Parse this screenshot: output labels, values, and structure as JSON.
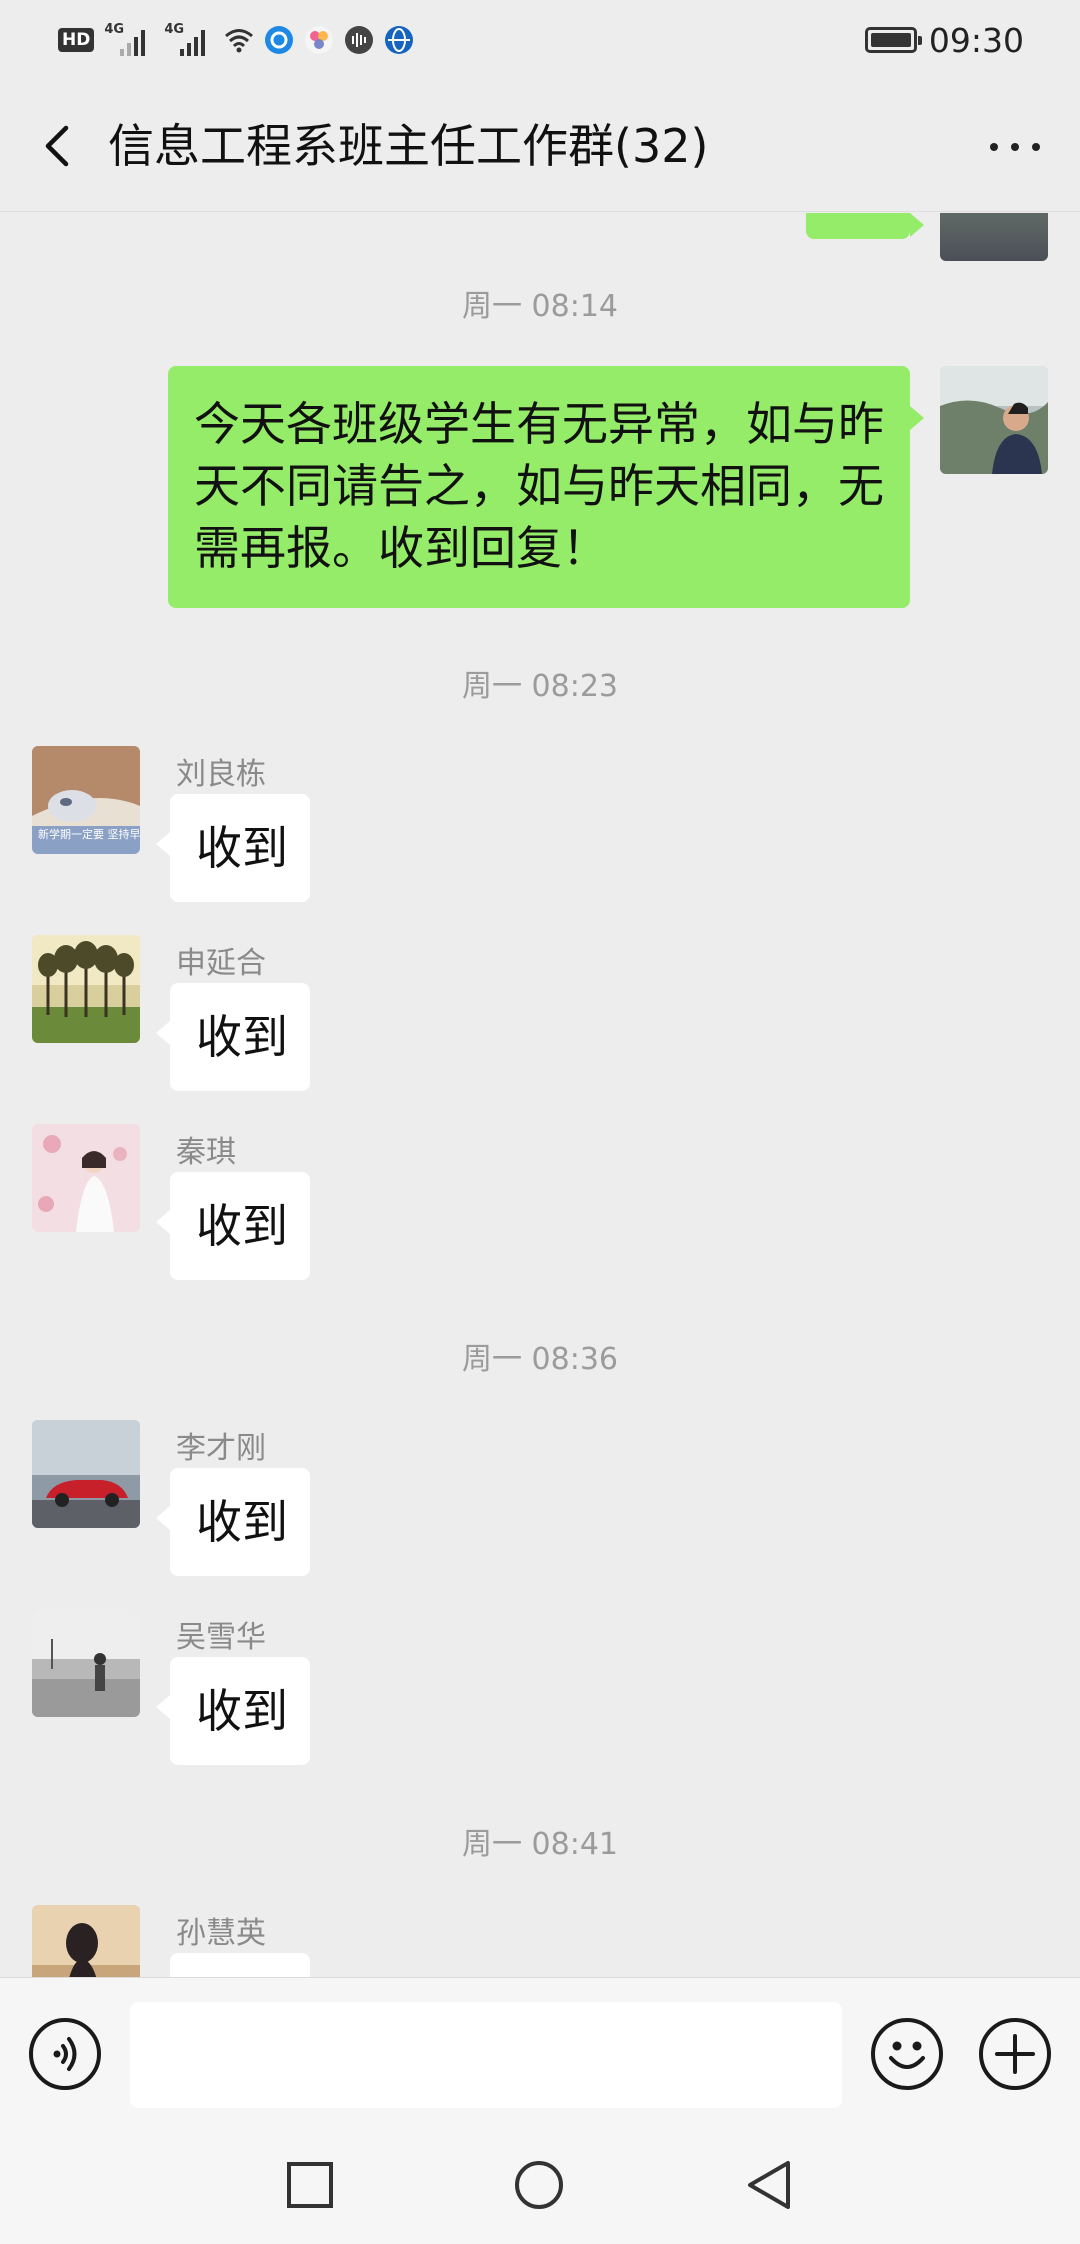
{
  "status_bar": {
    "hd_label": "HD",
    "sim1_label": "4G",
    "sim2_label": "4G",
    "time": "09:30"
  },
  "header": {
    "title": "信息工程系班主任工作群(32)"
  },
  "chat": {
    "messages": [
      {
        "type": "timestamp",
        "text": "周一 08:14"
      },
      {
        "type": "outgoing",
        "text": "今天各班级学生有无异常，如与昨天不同请告之，如与昨天相同，无需再报。收到回复！",
        "lines": [
          "今天各班级学生有无异常，如与昨",
          "天不同请告之，如与昨天相同，无",
          "需再报。收到回复！"
        ]
      },
      {
        "type": "timestamp",
        "text": "周一 08:23"
      },
      {
        "type": "incoming",
        "sender": "刘良栋",
        "text": "收到",
        "avatar_caption": "新学期一定要 坚持早睡早起"
      },
      {
        "type": "incoming",
        "sender": "申延合",
        "text": "收到"
      },
      {
        "type": "incoming",
        "sender": "秦琪",
        "text": "收到"
      },
      {
        "type": "timestamp",
        "text": "周一 08:36"
      },
      {
        "type": "incoming",
        "sender": "李才刚",
        "text": "收到"
      },
      {
        "type": "incoming",
        "sender": "吴雪华",
        "text": "收到"
      },
      {
        "type": "timestamp",
        "text": "周一 08:41"
      },
      {
        "type": "incoming",
        "sender": "孙慧英",
        "text": ""
      }
    ]
  },
  "input_bar": {
    "value": "",
    "placeholder": ""
  },
  "icons": {
    "back": "chevron-left-icon",
    "more": "more-dots-icon",
    "voice": "voice-input-icon",
    "emoji": "emoji-icon",
    "add": "plus-icon",
    "recents": "square-icon",
    "home": "circle-icon",
    "back_nav": "triangle-back-icon"
  },
  "colors": {
    "background": "#ededed",
    "outgoing_bubble": "#95ec69",
    "incoming_bubble": "#ffffff",
    "timestamp_text": "#9b9b9b",
    "sender_text": "#8a8a8a"
  }
}
